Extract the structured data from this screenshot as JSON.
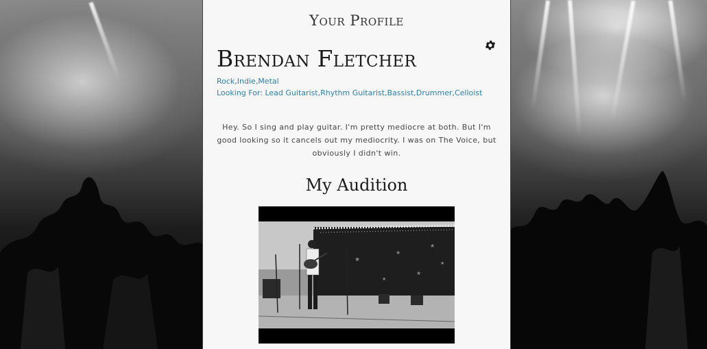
{
  "header": {
    "title": "Your Profile"
  },
  "profile": {
    "name": "Brendan Fletcher",
    "genres": "Rock,Indie,Metal",
    "looking_for": "Looking For: Lead Guitarist,Rhythm Guitarist,Bassist,Drummer,Celloist",
    "bio": "Hey. So I sing and play guitar. I'm pretty mediocre at both. But I'm good looking so it cancels out my mediocrity. I was on The Voice, but obviously I didn't win."
  },
  "audition": {
    "title": "My Audition"
  },
  "icons": {
    "settings": "gear-icon"
  },
  "colors": {
    "panel_bg": "#f7f7f7",
    "accent_text": "#2d7fa6",
    "heading": "#1a1a1a"
  }
}
